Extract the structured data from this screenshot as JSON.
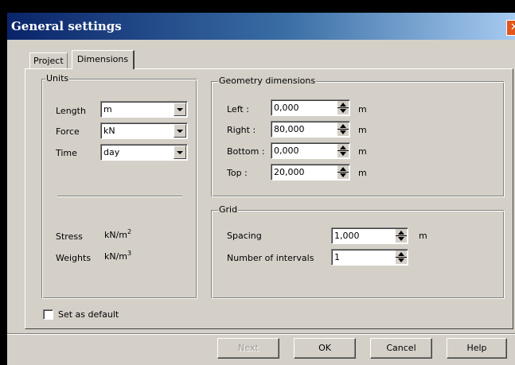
{
  "window": {
    "title": "General settings",
    "close_glyph": "✕"
  },
  "tabs": [
    {
      "label": "Project",
      "selected": false
    },
    {
      "label": "Dimensions",
      "selected": true
    }
  ],
  "units": {
    "legend": "Units",
    "length_label": "Length",
    "length_value": "m",
    "force_label": "Force",
    "force_value": "kN",
    "time_label": "Time",
    "time_value": "day",
    "stress_label": "Stress",
    "stress_unit": "kN/m",
    "stress_exp": "2",
    "weights_label": "Weights",
    "weights_unit": "kN/m",
    "weights_exp": "3"
  },
  "geometry": {
    "legend": "Geometry dimensions",
    "left_label": "Left :",
    "left_value": "0,000",
    "right_label": "Right :",
    "right_value": "80,000",
    "bottom_label": "Bottom :",
    "bottom_value": "0,000",
    "top_label": "Top :",
    "top_value": "20,000",
    "unit": "m"
  },
  "grid": {
    "legend": "Grid",
    "spacing_label": "Spacing",
    "spacing_value": "1,000",
    "spacing_unit": "m",
    "intervals_label": "Number of intervals",
    "intervals_value": "1"
  },
  "set_default": {
    "label": "Set as default",
    "checked": false
  },
  "buttons": {
    "next": "Next",
    "ok": "OK",
    "cancel": "Cancel",
    "help": "Help"
  }
}
